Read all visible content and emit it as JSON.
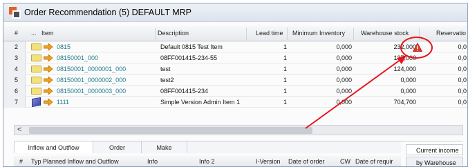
{
  "window": {
    "title": "Order Recommendation (5) DEFAULT MRP"
  },
  "grid": {
    "columns": {
      "rownum": "#",
      "dots": "...",
      "item": "Item",
      "description": "Description",
      "lead_time": "Lead time",
      "min_inventory": "Minimum Inventory",
      "warehouse_stock": "Warehouse stock",
      "reservation": "Reservatio"
    },
    "rows": [
      {
        "n": "2",
        "icon": "folder-icon",
        "item": "0815",
        "description": "Default 0815 Test Item",
        "lead_time": "1",
        "min_inventory": "0,000",
        "warehouse_stock": "232,000",
        "reservation": "0,0"
      },
      {
        "n": "3",
        "icon": "folder-icon",
        "item": "08150001_000",
        "description": "08FF001415-234-55",
        "lead_time": "1",
        "min_inventory": "0,000",
        "warehouse_stock": "137,000",
        "reservation": "0,0"
      },
      {
        "n": "4",
        "icon": "folder-icon",
        "item": "08150001_0000001_000",
        "description": "test",
        "lead_time": "1",
        "min_inventory": "0,000",
        "warehouse_stock": "124,000",
        "reservation": "0,0"
      },
      {
        "n": "5",
        "icon": "folder-icon",
        "item": "08150001_0000002_000",
        "description": "test2",
        "lead_time": "1",
        "min_inventory": "0,000",
        "warehouse_stock": "0,000",
        "reservation": "0,0"
      },
      {
        "n": "6",
        "icon": "folder-icon",
        "item": "08150001_0000003_000",
        "description": "08FF001415-234",
        "lead_time": "1",
        "min_inventory": "0,000",
        "warehouse_stock": "0,000",
        "reservation": "0,0"
      },
      {
        "n": "7",
        "icon": "cube-icon",
        "item": "1111",
        "description": "Simple Version Admin Item 1",
        "lead_time": "1",
        "min_inventory": "0,000",
        "warehouse_stock": "704,700",
        "reservation": "0,0"
      }
    ]
  },
  "scrollbar": {
    "left_arrow": "<"
  },
  "bottom_tabs": [
    "Inflow and Outflow",
    "Order",
    "Make"
  ],
  "bottom_columns": {
    "rownum": "#",
    "type": "Typ",
    "planned": "Planned Inflow and Outflow",
    "info": "Info",
    "info2": "Info 2",
    "iversion": "I-Version",
    "date_of_order": "Date of order",
    "cw": "CW",
    "date_required": "Date of requir"
  },
  "right_tabs": {
    "current_income": "Current income",
    "by_warehouse": "by Warehouse"
  },
  "colors": {
    "link": "#1d7a8c",
    "annotation": "#e3161c",
    "warning": "#e03a2e"
  }
}
